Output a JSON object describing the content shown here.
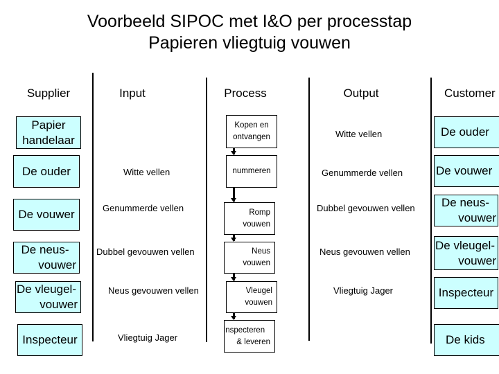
{
  "title": {
    "line1": "Voorbeeld SIPOC met I&O per processtap",
    "line2": "Papieren vliegtuig vouwen"
  },
  "columns": {
    "supplier": "Supplier",
    "input": "Input",
    "process": "Process",
    "output": "Output",
    "customer": "Customer"
  },
  "colors": {
    "box_fill": "#CCFFFF",
    "border": "#000000"
  },
  "suppliers": [
    {
      "lines": [
        "Papier",
        "handelaar"
      ]
    },
    {
      "lines": [
        "De ouder"
      ]
    },
    {
      "lines": [
        "De vouwer"
      ]
    },
    {
      "lines": [
        "De neus-",
        "vouwer"
      ]
    },
    {
      "lines": [
        "De vleugel-",
        "vouwer"
      ]
    },
    {
      "lines": [
        "Inspecteur"
      ]
    }
  ],
  "inputs": [
    "Witte vellen",
    "Genummerde vellen",
    "Dubbel gevouwen vellen",
    "Neus gevouwen vellen",
    "Vliegtuig Jager"
  ],
  "processes": [
    {
      "lines": [
        "Kopen en",
        "ontvangen"
      ]
    },
    {
      "lines": [
        "nummeren"
      ]
    },
    {
      "lines": [
        "Romp",
        "vouwen"
      ]
    },
    {
      "lines": [
        "Neus",
        "vouwen"
      ]
    },
    {
      "lines": [
        "Vleugel",
        "vouwen"
      ]
    },
    {
      "lines": [
        "Inspecteren",
        "& leveren"
      ]
    }
  ],
  "outputs": [
    "Witte vellen",
    "Genummerde vellen",
    "Dubbel gevouwen vellen",
    "Neus gevouwen vellen",
    "Vliegtuig Jager"
  ],
  "customers": [
    {
      "lines": [
        "De ouder"
      ]
    },
    {
      "lines": [
        "De vouwer"
      ]
    },
    {
      "lines": [
        "De neus-",
        "vouwer"
      ]
    },
    {
      "lines": [
        "De vleugel-",
        "vouwer"
      ]
    },
    {
      "lines": [
        "Inspecteur"
      ]
    },
    {
      "lines": [
        "De kids"
      ]
    }
  ]
}
